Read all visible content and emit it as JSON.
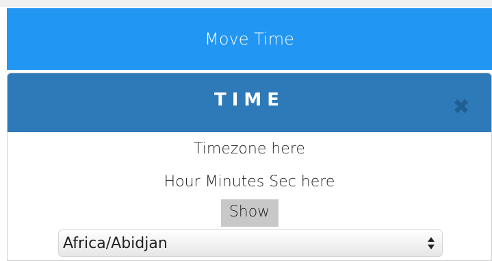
{
  "move_bar": {
    "label": "Move Time"
  },
  "panel": {
    "title": "TIME",
    "close_icon": "close-icon",
    "timezone_text": "Timezone here",
    "time_text": "Hour Minutes Sec here",
    "show_label": "Show",
    "timezone_select": {
      "selected": "Africa/Abidjan"
    }
  },
  "colors": {
    "move_bar_bg": "#2196f3",
    "panel_header_bg": "#2e79b8",
    "close_icon": "#1f5f91",
    "show_button_bg": "#c8c8c8"
  }
}
